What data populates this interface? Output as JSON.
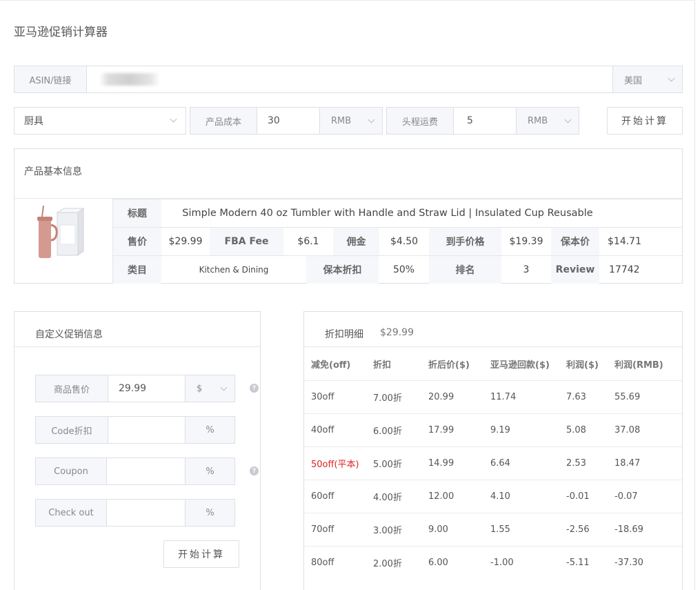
{
  "page": {
    "title": "亚马逊促销计算器"
  },
  "asin": {
    "label": "ASIN/链接",
    "value": "",
    "marketplace": "美国"
  },
  "params": {
    "category": "厨具",
    "cost_label": "产品成本",
    "cost_value": "30",
    "cost_currency": "RMB",
    "shipping_label": "头程运费",
    "shipping_value": "5",
    "shipping_currency": "RMB",
    "calc_button": "开始计算"
  },
  "product": {
    "section_title": "产品基本信息",
    "title_label": "标题",
    "title_value": "Simple Modern 40 oz Tumbler with Handle and Straw Lid | Insulated Cup Reusable",
    "price_label": "售价",
    "price_value": "$29.99",
    "fba_label": "FBA Fee",
    "fba_value": "$6.1",
    "commission_label": "佣金",
    "commission_value": "$4.50",
    "net_label": "到手价格",
    "net_value": "$19.39",
    "breakeven_label": "保本价",
    "breakeven_value": "$14.71",
    "category_label": "类目",
    "category_value": "Kitchen & Dining",
    "breakeven_discount_label": "保本折扣",
    "breakeven_discount_value": "50%",
    "rank_label": "排名",
    "rank_value": "3",
    "review_label": "Review",
    "review_value": "17742"
  },
  "custom": {
    "section_title": "自定义促销信息",
    "price_label": "商品售价",
    "price_value": "29.99",
    "price_unit": "$",
    "code_label": "Code折扣",
    "code_value": "",
    "code_unit": "%",
    "coupon_label": "Coupon",
    "coupon_value": "",
    "coupon_unit": "%",
    "checkout_label": "Check out",
    "checkout_value": "",
    "checkout_unit": "%",
    "calc_button": "开始计算",
    "help_icon": "?"
  },
  "discounts": {
    "section_title": "折扣明细",
    "price": "$29.99",
    "columns": [
      "减免(off)",
      "折扣",
      "折后价($)",
      "亚马逊回款($)",
      "利润($)",
      "利润(RMB)"
    ],
    "rows": [
      {
        "off": "30off",
        "discount": "7.00折",
        "price": "20.99",
        "payout": "11.74",
        "profit_usd": "7.63",
        "profit_rmb": "55.69"
      },
      {
        "off": "40off",
        "discount": "6.00折",
        "price": "17.99",
        "payout": "9.19",
        "profit_usd": "5.08",
        "profit_rmb": "37.08"
      },
      {
        "off": "50off(平本)",
        "discount": "5.00折",
        "price": "14.99",
        "payout": "6.64",
        "profit_usd": "2.53",
        "profit_rmb": "18.47"
      },
      {
        "off": "60off",
        "discount": "4.00折",
        "price": "12.00",
        "payout": "4.10",
        "profit_usd": "-0.01",
        "profit_rmb": "-0.07"
      },
      {
        "off": "70off",
        "discount": "3.00折",
        "price": "9.00",
        "payout": "1.55",
        "profit_usd": "-2.56",
        "profit_rmb": "-18.69"
      },
      {
        "off": "80off",
        "discount": "2.00折",
        "price": "6.00",
        "payout": "-1.00",
        "profit_usd": "-5.11",
        "profit_rmb": "-37.30"
      }
    ]
  },
  "colors": {
    "breakeven_red": "#e02020",
    "border": "#dcdfe6",
    "addon_bg": "#f5f7fa"
  }
}
